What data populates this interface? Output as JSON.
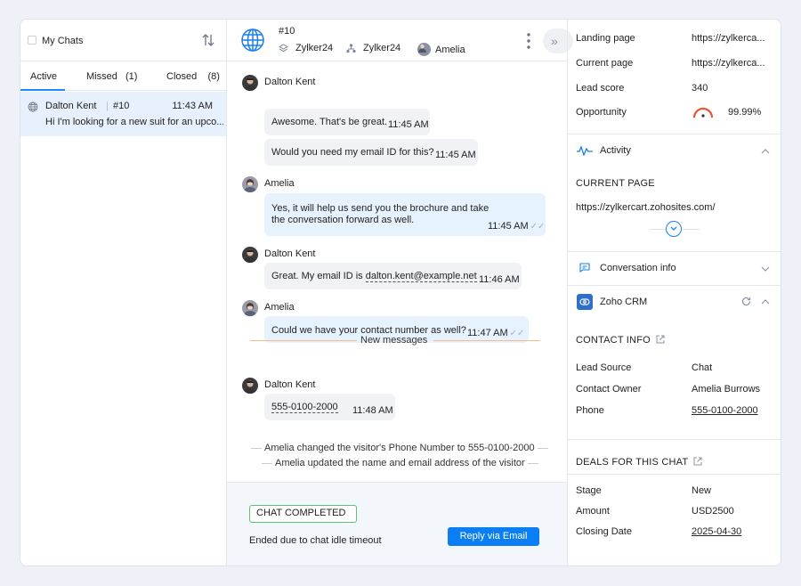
{
  "left": {
    "title": "My Chats",
    "tabs": [
      {
        "label": "Active"
      },
      {
        "label": "Missed",
        "count": "(1)"
      },
      {
        "label": "Closed",
        "count": "(8)"
      }
    ],
    "chat": {
      "name": "Dalton Kent",
      "number": "#10",
      "time": "11:43 AM",
      "preview": "Hi I'm looking for a new suit for an upco..."
    }
  },
  "header": {
    "id": "#10",
    "brand1": "Zylker24",
    "brand2": "Zylker24",
    "agent": "Amelia"
  },
  "messages": [
    {
      "sender": "Dalton Kent",
      "text": "Awesome. That's be great.",
      "time": "11:45 AM"
    },
    {
      "sender": "",
      "text": "Would you need my email ID for this?",
      "time": "11:45 AM"
    },
    {
      "sender": "Amelia",
      "line1": "Yes, it will help us send you the brochure and take",
      "line2": "the conversation forward as well.",
      "time": "11:45 AM"
    },
    {
      "sender": "Dalton Kent",
      "text_prefix": "Great. My email ID is ",
      "email": "dalton.kent@example.net",
      "time": "11:46 AM"
    },
    {
      "sender": "Amelia",
      "text": "Could we have your contact number as well?",
      "time": "11:47 AM"
    },
    {
      "sender": "Dalton Kent",
      "phone": "555-0100-2000",
      "time": "11:48 AM"
    }
  ],
  "new_messages": "New messages",
  "system": [
    "Amelia changed the visitor's Phone Number to 555-0100-2000",
    "Amelia updated the name and email address of the visitor"
  ],
  "footer": {
    "badge": "CHAT COMPLETED",
    "reason": "Ended due to chat idle timeout",
    "reply": "Reply via Email"
  },
  "right": {
    "landing_label": "Landing page",
    "landing_value": "https://zylkerca...",
    "current_label": "Current page",
    "current_value": "https://zylkerca...",
    "lead_label": "Lead score",
    "lead_value": "340",
    "opp_label": "Opportunity",
    "opp_value": "99.99%",
    "activity": "Activity",
    "current_page_heading": "CURRENT PAGE",
    "current_page_url": "https://zylkercart.zohosites.com/",
    "conv_info": "Conversation info",
    "crm": "Zoho CRM",
    "contact_info": "CONTACT INFO",
    "lead_source_label": "Lead Source",
    "lead_source_value": "Chat",
    "owner_label": "Contact Owner",
    "owner_value": "Amelia Burrows",
    "phone_label": "Phone",
    "phone_value": "555-0100-2000",
    "deals": "DEALS FOR THIS CHAT",
    "stage_label": "Stage",
    "stage_value": "New",
    "amount_label": "Amount",
    "amount_value": "USD2500",
    "closing_label": "Closing Date",
    "closing_value": "2025-04-30"
  },
  "colors": {
    "accent": "#0a7ef2",
    "selected_bg": "#e6f1fd",
    "completed": "#5fbf7c",
    "new_line": "#f5b98a"
  }
}
